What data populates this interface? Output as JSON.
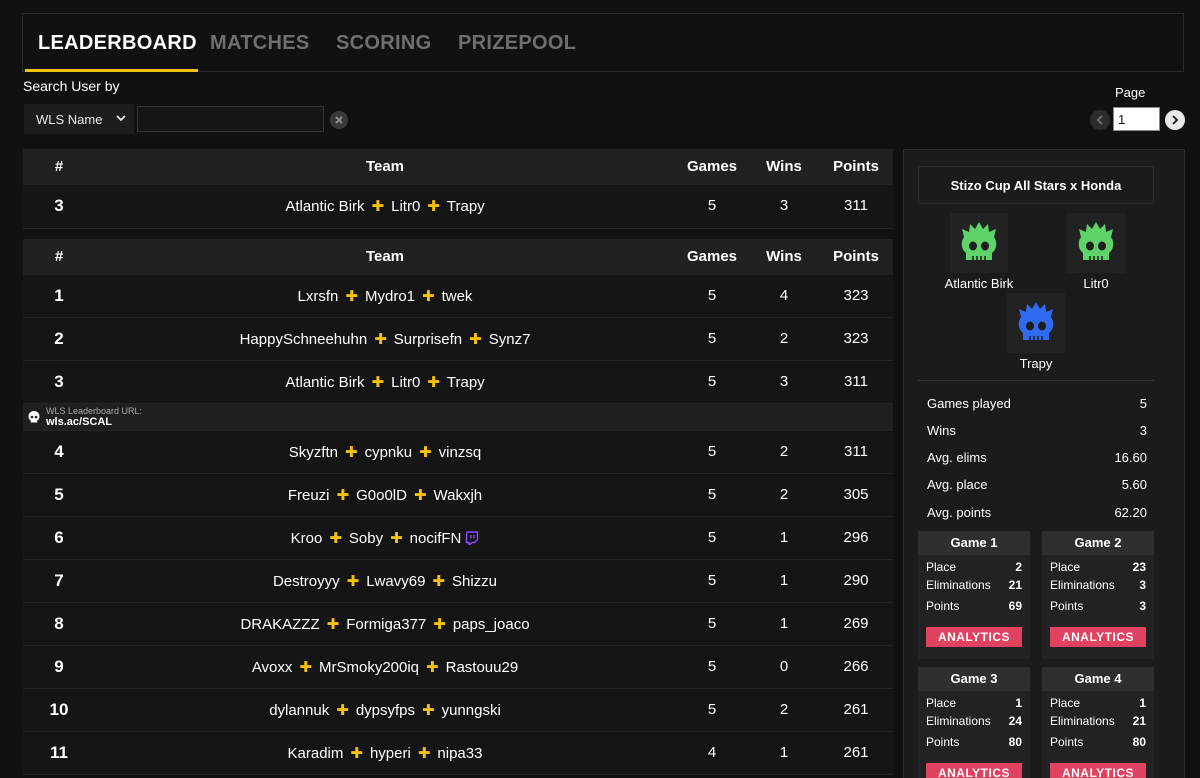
{
  "tabs": [
    {
      "label": "LEADERBOARD",
      "active": true
    },
    {
      "label": "MATCHES",
      "active": false
    },
    {
      "label": "SCORING",
      "active": false
    },
    {
      "label": "PRIZEPOOL",
      "active": false
    }
  ],
  "search": {
    "label": "Search User by",
    "select_value": "WLS Name",
    "input_value": "",
    "input_placeholder": ""
  },
  "pagination": {
    "label": "Page",
    "current": "1"
  },
  "table": {
    "headers": {
      "rank": "#",
      "team": "Team",
      "games": "Games",
      "wins": "Wins",
      "points": "Points"
    },
    "highlighted_row": {
      "rank": "3",
      "players": [
        "Atlantic Birk",
        "Litr0",
        "Trapy"
      ],
      "games": "5",
      "wins": "3",
      "points": "311"
    },
    "rows": [
      {
        "rank": "1",
        "players": [
          "Lxrsfn",
          "Mydro1",
          "twek"
        ],
        "games": "5",
        "wins": "4",
        "points": "323"
      },
      {
        "rank": "2",
        "players": [
          "HappySchneehuhn",
          "Surprisefn",
          "Synz7"
        ],
        "games": "5",
        "wins": "2",
        "points": "323"
      },
      {
        "rank": "3",
        "players": [
          "Atlantic Birk",
          "Litr0",
          "Trapy"
        ],
        "games": "5",
        "wins": "3",
        "points": "311"
      },
      {
        "rank": "4",
        "players": [
          "Skyzftn",
          "cypnku",
          "vinzsq"
        ],
        "games": "5",
        "wins": "2",
        "points": "311"
      },
      {
        "rank": "5",
        "players": [
          "Freuzi",
          "G0o0lD",
          "Wakxjh"
        ],
        "games": "5",
        "wins": "2",
        "points": "305"
      },
      {
        "rank": "6",
        "players": [
          "Kroo",
          "Soby",
          "nocifFN"
        ],
        "games": "5",
        "wins": "1",
        "points": "296"
      },
      {
        "rank": "7",
        "players": [
          "Destroyyy",
          "Lwavy69",
          "Shizzu"
        ],
        "games": "5",
        "wins": "1",
        "points": "290"
      },
      {
        "rank": "8",
        "players": [
          "DRAKAZZZ",
          "Formiga377",
          "paps_joaco"
        ],
        "games": "5",
        "wins": "1",
        "points": "269"
      },
      {
        "rank": "9",
        "players": [
          "Avoxx",
          "MrSmoky200iq",
          "Rastouu29"
        ],
        "games": "5",
        "wins": "0",
        "points": "266"
      },
      {
        "rank": "10",
        "players": [
          "dylannuk",
          "dypsyfps",
          "yunngski"
        ],
        "games": "5",
        "wins": "2",
        "points": "261"
      },
      {
        "rank": "11",
        "players": [
          "Karadim",
          "hyperi",
          "nipa33"
        ],
        "games": "4",
        "wins": "1",
        "points": "261"
      }
    ]
  },
  "url_banner": {
    "small": "WLS Leaderboard URL:",
    "link": "wls.ac/SCAL",
    "icon": "wls-skull-icon"
  },
  "panel": {
    "event_title": "Stizo Cup All Stars x Honda",
    "players": [
      {
        "name": "Atlantic Birk",
        "skull_color": "#5ed36a"
      },
      {
        "name": "Litr0",
        "skull_color": "#5ed36a"
      },
      {
        "name": "Trapy",
        "skull_color": "#2f6bf0"
      }
    ],
    "stats": [
      {
        "label": "Games played",
        "value": "5"
      },
      {
        "label": "Wins",
        "value": "3"
      },
      {
        "label": "Avg. elims",
        "value": "16.60"
      },
      {
        "label": "Avg. place",
        "value": "5.60"
      },
      {
        "label": "Avg. points",
        "value": "62.20"
      }
    ],
    "games": [
      {
        "title": "Game 1",
        "place_label": "Place",
        "place": "2",
        "elims_label": "Eliminations",
        "elims": "21",
        "points_label": "Points",
        "points": "69",
        "button": "ANALYTICS"
      },
      {
        "title": "Game 2",
        "place_label": "Place",
        "place": "23",
        "elims_label": "Eliminations",
        "elims": "3",
        "points_label": "Points",
        "points": "3",
        "button": "ANALYTICS"
      },
      {
        "title": "Game 3",
        "place_label": "Place",
        "place": "1",
        "elims_label": "Eliminations",
        "elims": "24",
        "points_label": "Points",
        "points": "80",
        "button": "ANALYTICS"
      },
      {
        "title": "Game 4",
        "place_label": "Place",
        "place": "1",
        "elims_label": "Eliminations",
        "elims": "21",
        "points_label": "Points",
        "points": "80",
        "button": "ANALYTICS"
      }
    ]
  },
  "colors": {
    "accent": "#f4c20d",
    "analytics": "#e0425f",
    "twitch": "#9146ff"
  }
}
